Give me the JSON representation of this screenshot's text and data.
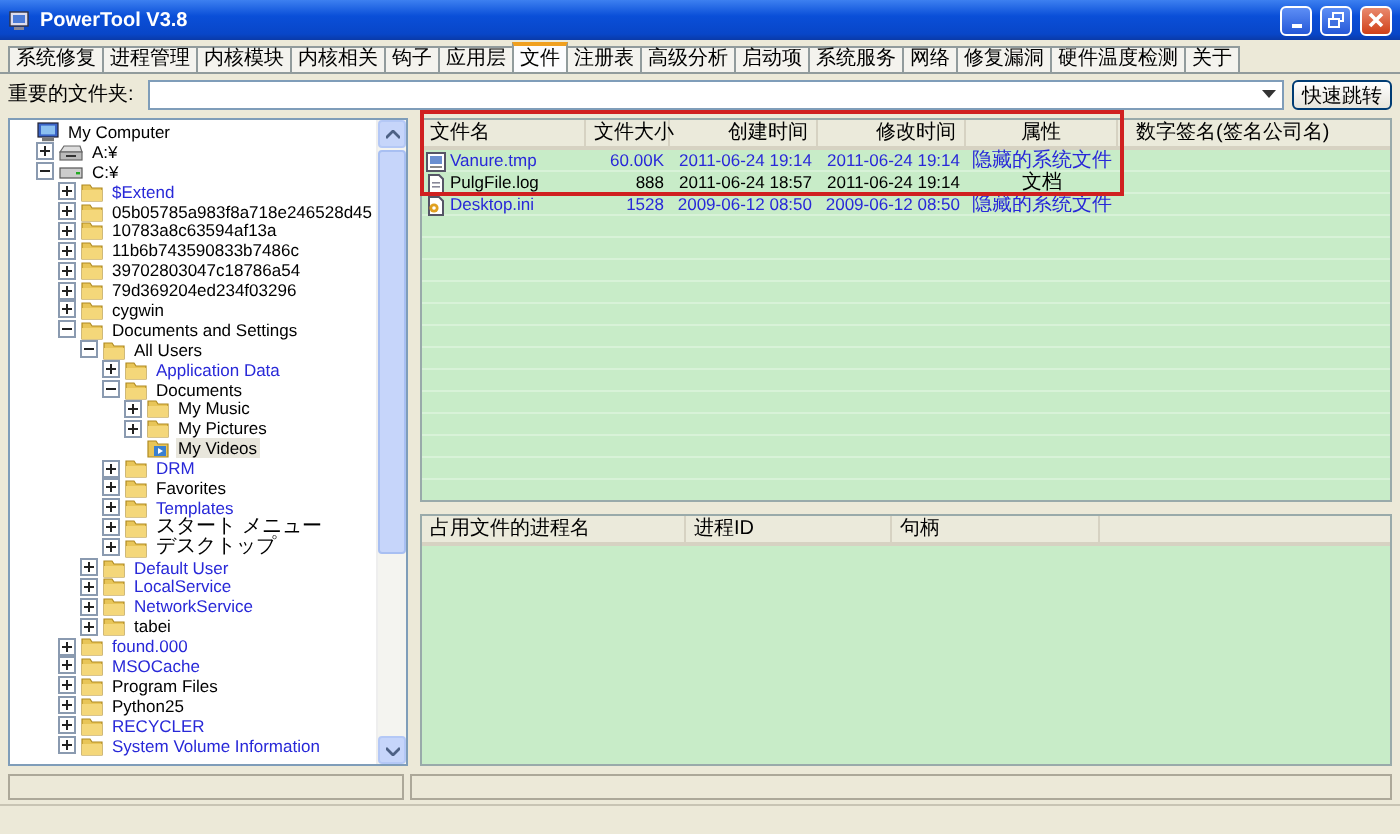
{
  "window": {
    "title": "PowerTool V3.8"
  },
  "tabs": [
    {
      "label": "系统修复",
      "selected": false
    },
    {
      "label": "进程管理",
      "selected": false
    },
    {
      "label": "内核模块",
      "selected": false
    },
    {
      "label": "内核相关",
      "selected": false
    },
    {
      "label": "钩子",
      "selected": false
    },
    {
      "label": "应用层",
      "selected": false
    },
    {
      "label": "文件",
      "selected": true
    },
    {
      "label": "注册表",
      "selected": false
    },
    {
      "label": "高级分析",
      "selected": false
    },
    {
      "label": "启动项",
      "selected": false
    },
    {
      "label": "系统服务",
      "selected": false
    },
    {
      "label": "网络",
      "selected": false
    },
    {
      "label": "修复漏洞",
      "selected": false
    },
    {
      "label": "硬件温度检测",
      "selected": false
    },
    {
      "label": "关于",
      "selected": false
    }
  ],
  "folder_bar": {
    "label": "重要的文件夹:",
    "button": "快速跳转"
  },
  "tree": [
    {
      "label": "My Computer",
      "kind": "computer",
      "hidden": false,
      "selected": false,
      "children": [
        {
          "label": "A:¥",
          "kind": "floppy",
          "hidden": false,
          "selected": false,
          "expanded": false
        },
        {
          "label": "C:¥",
          "kind": "drive",
          "hidden": false,
          "selected": false,
          "expanded": true,
          "children": [
            {
              "label": "$Extend",
              "kind": "folder",
              "hidden": true,
              "selected": false,
              "expanded": false
            },
            {
              "label": "05b05785a983f8a718e246528d45",
              "kind": "folder",
              "hidden": false,
              "selected": false,
              "expanded": false
            },
            {
              "label": "10783a8c63594af13a",
              "kind": "folder",
              "hidden": false,
              "selected": false,
              "expanded": false
            },
            {
              "label": "11b6b743590833b7486c",
              "kind": "folder",
              "hidden": false,
              "selected": false,
              "expanded": false
            },
            {
              "label": "39702803047c18786a54",
              "kind": "folder",
              "hidden": false,
              "selected": false,
              "expanded": false
            },
            {
              "label": "79d369204ed234f03296",
              "kind": "folder",
              "hidden": false,
              "selected": false,
              "expanded": false
            },
            {
              "label": "cygwin",
              "kind": "folder",
              "hidden": false,
              "selected": false,
              "expanded": false
            },
            {
              "label": "Documents and Settings",
              "kind": "folder",
              "hidden": false,
              "selected": false,
              "expanded": true,
              "children": [
                {
                  "label": "All Users",
                  "kind": "folder",
                  "hidden": false,
                  "selected": false,
                  "expanded": true,
                  "children": [
                    {
                      "label": "Application Data",
                      "kind": "folder",
                      "hidden": true,
                      "selected": false,
                      "expanded": false
                    },
                    {
                      "label": "Documents",
                      "kind": "folder",
                      "hidden": false,
                      "selected": false,
                      "expanded": true,
                      "children": [
                        {
                          "label": "My Music",
                          "kind": "folder",
                          "hidden": false,
                          "selected": false,
                          "expanded": false
                        },
                        {
                          "label": "My Pictures",
                          "kind": "folder",
                          "hidden": false,
                          "selected": false,
                          "expanded": false
                        },
                        {
                          "label": "My Videos",
                          "kind": "video",
                          "hidden": false,
                          "selected": true
                        }
                      ]
                    },
                    {
                      "label": "DRM",
                      "kind": "folder",
                      "hidden": true,
                      "selected": false,
                      "expanded": false
                    },
                    {
                      "label": "Favorites",
                      "kind": "folder",
                      "hidden": false,
                      "selected": false,
                      "expanded": false
                    },
                    {
                      "label": "Templates",
                      "kind": "folder",
                      "hidden": true,
                      "selected": false,
                      "expanded": false
                    },
                    {
                      "label": "スタート メニュー",
                      "kind": "folder",
                      "hidden": false,
                      "selected": false,
                      "expanded": false
                    },
                    {
                      "label": "デスクトップ",
                      "kind": "folder",
                      "hidden": false,
                      "selected": false,
                      "expanded": false
                    }
                  ]
                },
                {
                  "label": "Default User",
                  "kind": "folder",
                  "hidden": true,
                  "selected": false,
                  "expanded": false
                },
                {
                  "label": "LocalService",
                  "kind": "folder",
                  "hidden": true,
                  "selected": false,
                  "expanded": false
                },
                {
                  "label": "NetworkService",
                  "kind": "folder",
                  "hidden": true,
                  "selected": false,
                  "expanded": false
                },
                {
                  "label": "tabei",
                  "kind": "folder",
                  "hidden": false,
                  "selected": false,
                  "expanded": false
                }
              ]
            },
            {
              "label": "found.000",
              "kind": "folder",
              "hidden": true,
              "selected": false,
              "expanded": false
            },
            {
              "label": "MSOCache",
              "kind": "folder",
              "hidden": true,
              "selected": false,
              "expanded": false
            },
            {
              "label": "Program Files",
              "kind": "folder",
              "hidden": false,
              "selected": false,
              "expanded": false
            },
            {
              "label": "Python25",
              "kind": "folder",
              "hidden": false,
              "selected": false,
              "expanded": false
            },
            {
              "label": "RECYCLER",
              "kind": "folder",
              "hidden": true,
              "selected": false,
              "expanded": false
            },
            {
              "label": "System Volume Information",
              "kind": "folder",
              "hidden": true,
              "selected": false,
              "expanded": false
            }
          ]
        }
      ]
    }
  ],
  "files": {
    "columns": [
      "文件名",
      "文件大小",
      "创建时间",
      "修改时间",
      "属性",
      "数字签名(签名公司名)"
    ],
    "rows": [
      {
        "name": "Vanure.tmp",
        "kind": "image",
        "hidden": true,
        "size": "60.00K",
        "created": "2011-06-24 19:14",
        "modified": "2011-06-24 19:14",
        "attribute": "隐藏的系统文件"
      },
      {
        "name": "PulgFile.log",
        "kind": "document",
        "hidden": false,
        "size": "888",
        "created": "2011-06-24 18:57",
        "modified": "2011-06-24 19:14",
        "attribute": "文档"
      },
      {
        "name": "Desktop.ini",
        "kind": "settings",
        "hidden": true,
        "size": "1528",
        "created": "2009-06-12 08:50",
        "modified": "2009-06-12 08:50",
        "attribute": "隐藏的系统文件"
      }
    ]
  },
  "handles": {
    "columns": [
      "占用文件的进程名",
      "进程ID",
      "句柄"
    ]
  }
}
